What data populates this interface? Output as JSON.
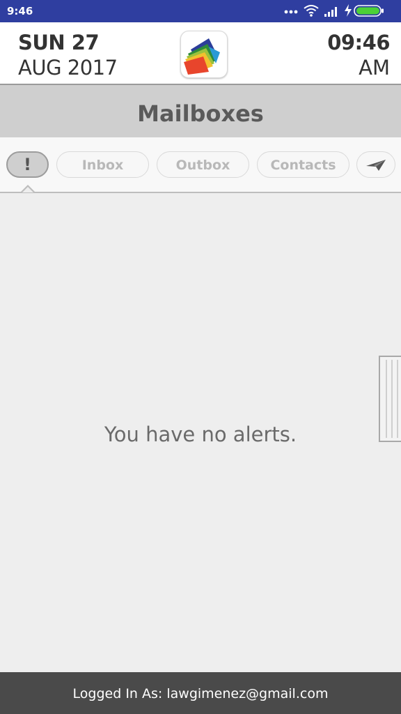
{
  "status_bar": {
    "time": "9:46",
    "icons": [
      "more-dots-icon",
      "wifi-icon",
      "signal-icon",
      "charging-icon",
      "battery-icon"
    ]
  },
  "header": {
    "date_line1": "SUN 27",
    "date_line2": "AUG 2017",
    "time_line1": "09:46",
    "time_line2": "AM",
    "logo_icon": "app-logo"
  },
  "title": "Mailboxes",
  "tabs": [
    {
      "label": "!",
      "icon": "alert-icon",
      "selected": true
    },
    {
      "label": "Inbox"
    },
    {
      "label": "Outbox"
    },
    {
      "label": "Contacts"
    },
    {
      "label": "",
      "icon": "send-icon"
    }
  ],
  "main": {
    "empty_message": "You have no alerts."
  },
  "footer": {
    "text": "Logged In As: lawgimenez@gmail.com"
  },
  "colors": {
    "status_bar": "#2f3ea0",
    "title_band": "#cfcfcf",
    "footer": "#4a4a4a",
    "background": "#eeeeee"
  }
}
